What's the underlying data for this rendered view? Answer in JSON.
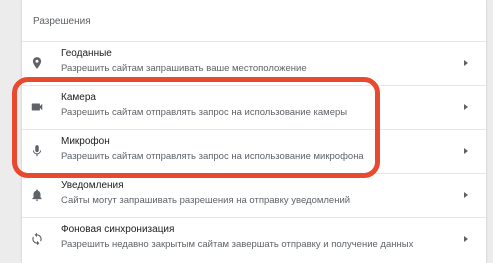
{
  "section": {
    "title": "Разрешения"
  },
  "rows": [
    {
      "title": "Геоданные",
      "desc": "Разрешить сайтам запрашивать ваше местоположение",
      "icon": "location-pin-icon"
    },
    {
      "title": "Камера",
      "desc": "Разрешить сайтам отправлять запрос на использование камеры",
      "icon": "camera-icon"
    },
    {
      "title": "Микрофон",
      "desc": "Разрешить сайтам отправлять запрос на использование микрофона",
      "icon": "microphone-icon"
    },
    {
      "title": "Уведомления",
      "desc": "Сайты могут запрашивать разрешения на отправку уведомлений",
      "icon": "bell-icon"
    },
    {
      "title": "Фоновая синхронизация",
      "desc": "Разрешить недавно закрытым сайтам завершать отправку и получение данных",
      "icon": "sync-icon"
    }
  ],
  "colors": {
    "highlight": "#e84a2f",
    "icon": "#5f6368",
    "title": "#202124",
    "desc": "#5f6368"
  }
}
